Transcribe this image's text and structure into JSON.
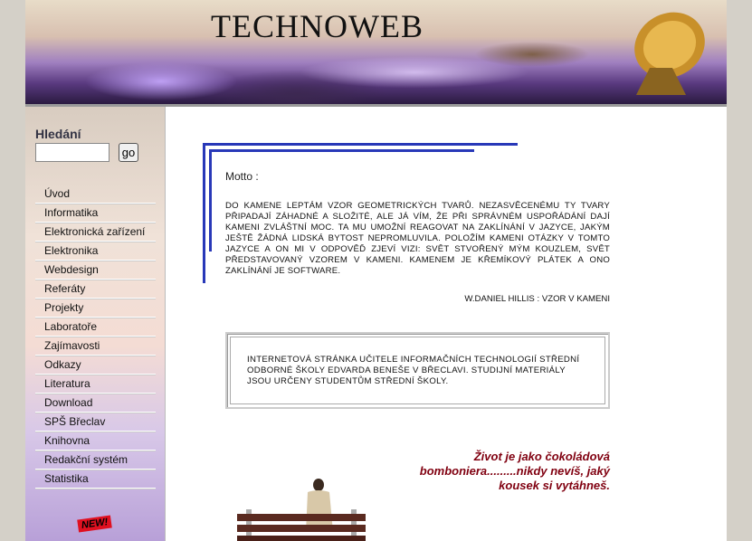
{
  "header": {
    "title": "TECHNOWEB"
  },
  "search": {
    "label": "Hledání",
    "value": "",
    "button": "go"
  },
  "nav": {
    "items": [
      "Úvod",
      "Informatika",
      "Elektronická zařízení",
      "Elektronika",
      "Webdesign",
      "Referáty",
      "Projekty",
      "Laboratoře",
      "Zajímavosti",
      "Odkazy",
      "Literatura",
      "Download",
      "SPŠ Břeclav",
      "Knihovna",
      "Redakční systém",
      "Statistika"
    ]
  },
  "badge": {
    "new": "NEW!"
  },
  "motto": {
    "label": "Motto :",
    "text": "DO KAMENE LEPTÁM VZOR GEOMETRICKÝCH TVARŮ. NEZASVĚCENÉMU TY TVARY PŘIPADAJÍ ZÁHADNÉ A SLOŽITÉ, ALE JÁ VÍM, ŽE PŘI SPRÁVNÉM USPOŘÁDÁNÍ DAJÍ KAMENI ZVLÁŠTNÍ MOC. TA MU UMOŽNÍ REAGOVAT NA ZAKLÍNÁNÍ V JAZYCE, JAKÝM JEŠTĚ ŽÁDNÁ LIDSKÁ BYTOST NEPROMLUVILA. POLOŽÍM KAMENI OTÁZKY V TOMTO JAZYCE A ON MI V ODPOVĚĎ ZJEVÍ VIZI: SVĚT STVOŘENÝ MÝM KOUZLEM, SVĚT PŘEDSTAVOVANÝ VZOREM V KAMENI. KAMENEM JE KŘEMÍKOVÝ PLÁTEK A ONO ZAKLÍNÁNÍ JE SOFTWARE.",
    "author": "W.DANIEL HILLIS : VZOR V KAMENI"
  },
  "info": {
    "text": "INTERNETOVÁ STRÁNKA UČITELE INFORMAČNÍCH TECHNOLOGIÍ STŘEDNÍ ODBORNÉ ŠKOLY EDVARDA BENEŠE V BŘECLAVI. STUDIJNÍ MATERIÁLY JSOU URČENY STUDENTŮM STŘEDNÍ ŠKOLY."
  },
  "quote": {
    "text": "Život je jako čokoládová bomboniera.........nikdy nevíš, jaký kousek si vytáhneš."
  },
  "colors": {
    "frame": "#2838b8",
    "quote": "#800010"
  }
}
